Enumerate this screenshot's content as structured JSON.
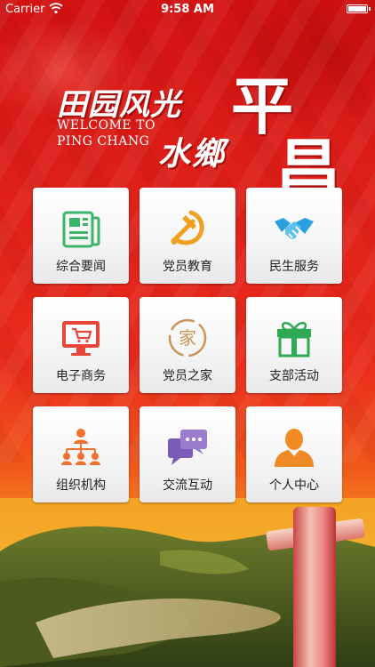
{
  "status_bar": {
    "carrier": "Carrier",
    "time": "9:58 AM"
  },
  "header": {
    "slogan_line1": "田园风光",
    "slogan_line2": "水鄉",
    "welcome_line1": "WELCOME TO",
    "welcome_line2": "PING CHANG",
    "title_char1": "平",
    "title_char2": "昌"
  },
  "menu": [
    {
      "label": "综合要闻",
      "icon": "newspaper-icon",
      "color": "#3bb56a"
    },
    {
      "label": "党员教育",
      "icon": "hammer-sickle-icon",
      "color": "#f0a020"
    },
    {
      "label": "民生服务",
      "icon": "handshake-icon",
      "color": "#2aa0e0"
    },
    {
      "label": "电子商务",
      "icon": "cart-monitor-icon",
      "color": "#e8463a"
    },
    {
      "label": "党员之家",
      "icon": "home-seal-icon",
      "color": "#c9955a"
    },
    {
      "label": "支部活动",
      "icon": "gift-icon",
      "color": "#2eaa55"
    },
    {
      "label": "组织机构",
      "icon": "org-chart-icon",
      "color": "#f07030"
    },
    {
      "label": "交流互动",
      "icon": "chat-bubbles-icon",
      "color": "#7a5bb5"
    },
    {
      "label": "个人中心",
      "icon": "person-icon",
      "color": "#f08a24"
    }
  ]
}
